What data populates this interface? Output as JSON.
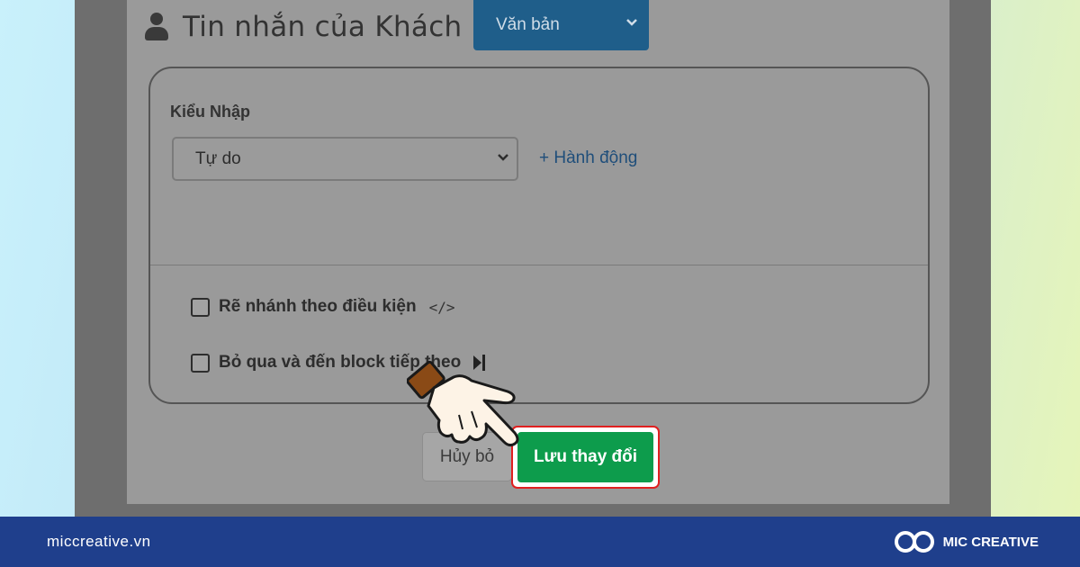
{
  "header": {
    "title": "Tin nhắn của Khách",
    "title_icon": "user-icon",
    "type_select_value": "Văn bản"
  },
  "card": {
    "input_label": "Kiểu Nhập",
    "input_select_value": "Tự do",
    "action_link": "+ Hành động",
    "options": [
      {
        "label": "Rẽ nhánh theo điều kiện",
        "icon": "code-icon",
        "checked": false
      },
      {
        "label": "Bỏ qua và đến block tiếp theo",
        "icon": "skip-next-icon",
        "checked": false
      }
    ]
  },
  "actions": {
    "cancel_label": "Hủy bỏ",
    "save_label": "Lưu thay đổi",
    "save_color": "#0d9c4c",
    "highlight_color": "#e02020"
  },
  "footer": {
    "url": "miccreative.vn",
    "brand": "MIC CREATIVE",
    "background": "#1f3f8c"
  }
}
